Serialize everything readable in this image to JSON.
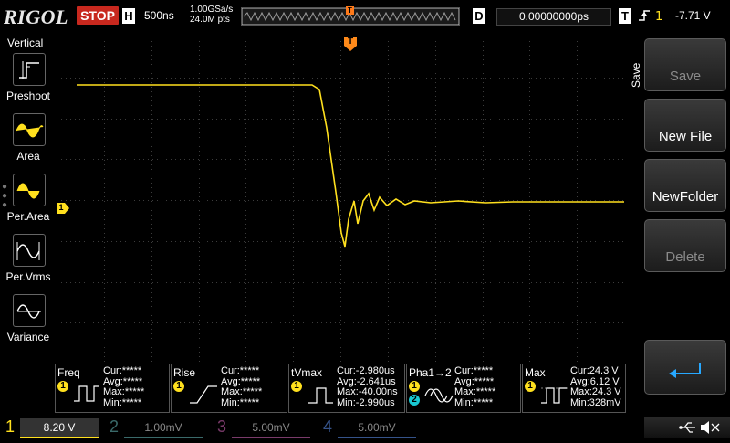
{
  "topbar": {
    "logo": "RIGOL",
    "run_state": "STOP",
    "timebase_key": "H",
    "timebase": "500ns",
    "sample_rate": "1.00GSa/s",
    "memory_depth": "24.0M pts",
    "trigger_marker": "T",
    "delay_key": "D",
    "delay": "0.00000000ps",
    "trigger_key": "T",
    "trigger_level": "-7.71 V"
  },
  "left_menu": {
    "title": "Vertical",
    "items": [
      {
        "label": "Preshoot",
        "icon": "preshoot-icon"
      },
      {
        "label": "Area",
        "icon": "area-icon"
      },
      {
        "label": "Per.Area",
        "icon": "per-area-icon"
      },
      {
        "label": "Per.Vrms",
        "icon": "per-vrms-icon"
      },
      {
        "label": "Variance",
        "icon": "variance-icon"
      }
    ]
  },
  "waveform": {
    "channel": "1",
    "color": "#ffe01e",
    "trigger_marker_label": "T",
    "channel_marker_label": "1",
    "trigger_level_marker_label": "T"
  },
  "right_panel": {
    "title": "Save",
    "buttons": [
      {
        "label": "Save",
        "enabled": false
      },
      {
        "label": "New File",
        "enabled": true
      },
      {
        "label": "NewFolder",
        "enabled": true
      },
      {
        "label": "Delete",
        "enabled": false
      }
    ],
    "enter_icon": "return-arrow-icon"
  },
  "measurements": [
    {
      "name": "Freq",
      "source": "1",
      "rows": [
        "Cur:*****",
        "Avg:*****",
        "Max:*****",
        "Min:*****"
      ]
    },
    {
      "name": "Rise",
      "source": "1",
      "rows": [
        "Cur:*****",
        "Avg:*****",
        "Max:*****",
        "Min:*****"
      ]
    },
    {
      "name": "tVmax",
      "source": "1",
      "rows": [
        "Cur:-2.980us",
        "Avg:-2.641us",
        "Max:-40.00ns",
        "Min:-2.990us"
      ]
    },
    {
      "name": "Pha1→2",
      "source": "1",
      "source2": "2",
      "rows": [
        "Cur:*****",
        "Avg:*****",
        "Max:*****",
        "Min:*****"
      ]
    },
    {
      "name": "Max",
      "source": "1",
      "rows": [
        "Cur:24.3 V",
        "Avg:6.12 V",
        "Max:24.3 V",
        "Min:328mV"
      ]
    }
  ],
  "channels": [
    {
      "num": "1",
      "scale": "8.20 V",
      "color": "#ffe01e"
    },
    {
      "num": "2",
      "scale": "1.00mV",
      "color": "#19c8d2"
    },
    {
      "num": "3",
      "scale": "5.00mV",
      "color": "#e040a0"
    },
    {
      "num": "4",
      "scale": "5.00mV",
      "color": "#3a6fe0"
    }
  ]
}
